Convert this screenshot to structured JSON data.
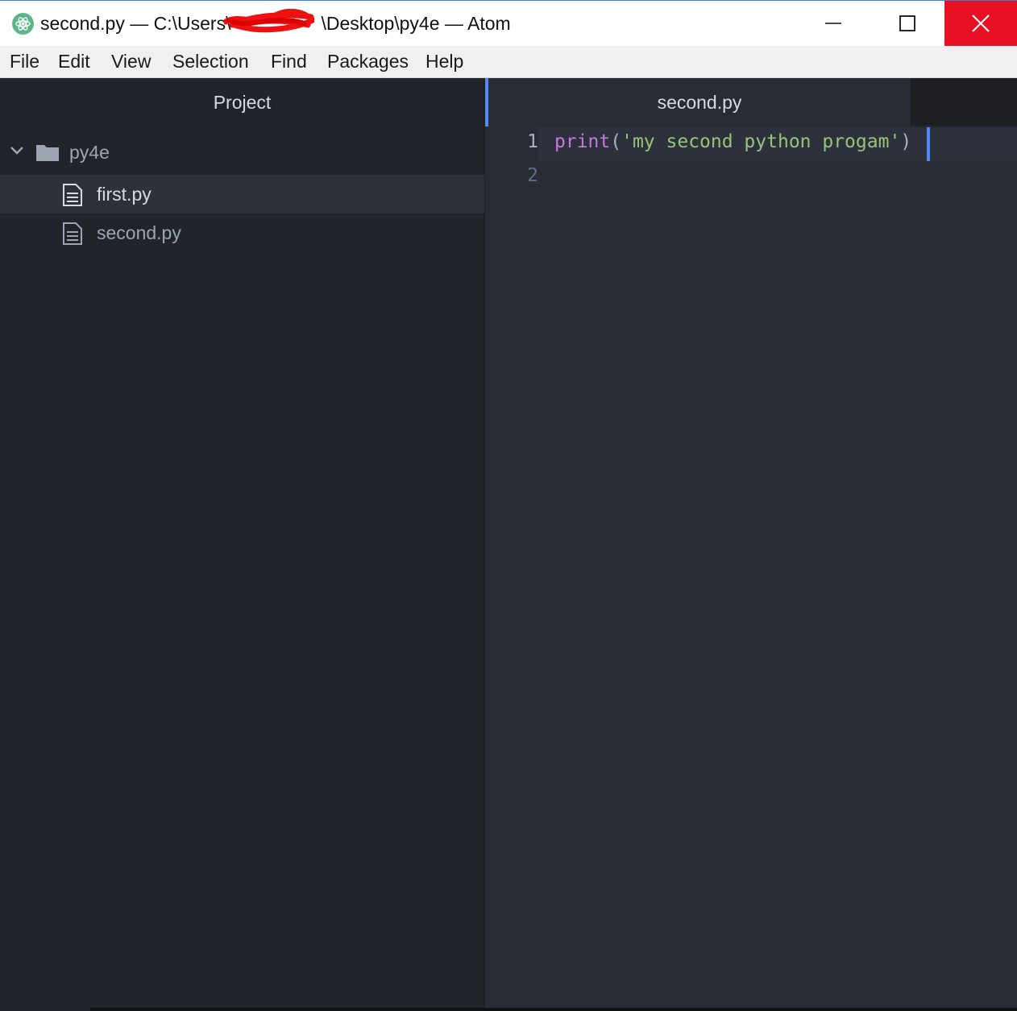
{
  "window": {
    "title_prefix": "second.py — C:\\Users\\",
    "title_suffix": "\\Desktop\\py4e — Atom",
    "close_color": "#e81123"
  },
  "menu": {
    "items": [
      "File",
      "Edit",
      "View",
      "Selection",
      "Find",
      "Packages",
      "Help"
    ]
  },
  "tree": {
    "header": "Project",
    "folder": "py4e",
    "files": [
      "first.py",
      "second.py"
    ],
    "selected_file": "first.py"
  },
  "editor": {
    "tab_title": "second.py",
    "line_numbers": [
      "1",
      "2"
    ],
    "code": {
      "fn": "print",
      "open_paren": "(",
      "string_body": "'my second python progam",
      "string_close": "'",
      "close_paren": ")"
    },
    "colors": {
      "keyword": "#c678dd",
      "string": "#98c379",
      "accent": "#568af2"
    }
  }
}
